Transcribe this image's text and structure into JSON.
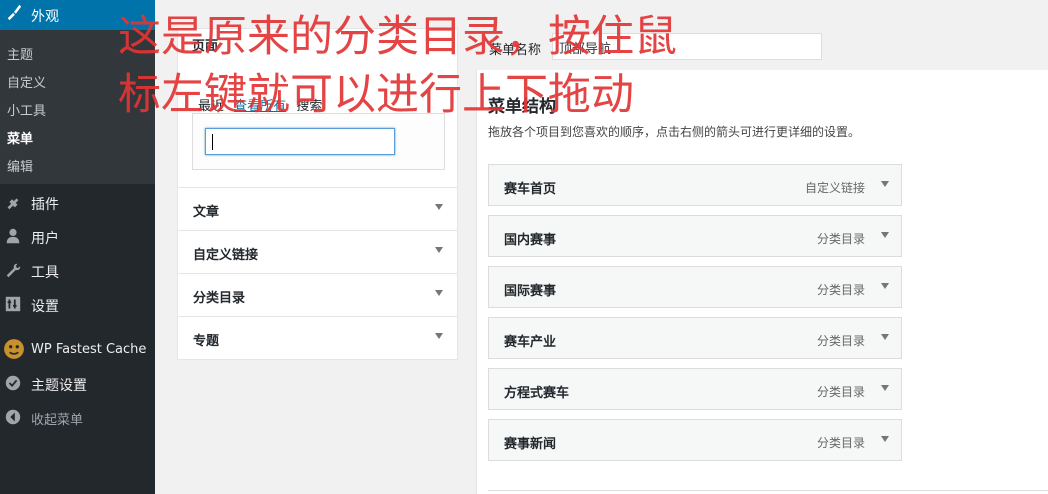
{
  "sidebar": {
    "active_menu": "外观",
    "submenu": [
      "主题",
      "自定义",
      "小工具",
      "菜单",
      "编辑"
    ],
    "current_submenu": "菜单",
    "menu_items": [
      {
        "label": "插件",
        "icon": "plugin-icon"
      },
      {
        "label": "用户",
        "icon": "user-icon"
      },
      {
        "label": "工具",
        "icon": "wrench-icon"
      },
      {
        "label": "设置",
        "icon": "settings-icon"
      },
      {
        "label": "WP Fastest Cache",
        "icon": "cheetah-icon"
      },
      {
        "label": "主题设置",
        "icon": "theme-settings-icon"
      },
      {
        "label": "收起菜单",
        "icon": "collapse-icon"
      }
    ]
  },
  "left_panel": {
    "pages_title": "页面",
    "tabs": [
      "最近",
      "查看所有",
      "搜索"
    ],
    "search_value": "",
    "sections": [
      "文章",
      "自定义链接",
      "分类目录",
      "专题"
    ]
  },
  "menu_name": {
    "label": "菜单名称",
    "value": "顶部导航"
  },
  "structure": {
    "title": "菜单结构",
    "description": "拖放各个项目到您喜欢的顺序，点击右侧的箭头可进行更详细的设置。",
    "items": [
      {
        "title": "赛车首页",
        "type": "自定义链接"
      },
      {
        "title": "国内赛事",
        "type": "分类目录"
      },
      {
        "title": "国际赛事",
        "type": "分类目录"
      },
      {
        "title": "赛车产业",
        "type": "分类目录"
      },
      {
        "title": "方程式赛车",
        "type": "分类目录"
      },
      {
        "title": "赛事新闻",
        "type": "分类目录"
      }
    ]
  },
  "annotation": "这是原来的分类目录，按住鼠标左键就可以进行上下拖动",
  "colors": {
    "sidebar_bg": "#23282d",
    "active_blue": "#0073aa",
    "annotation_red": "#e23434"
  }
}
